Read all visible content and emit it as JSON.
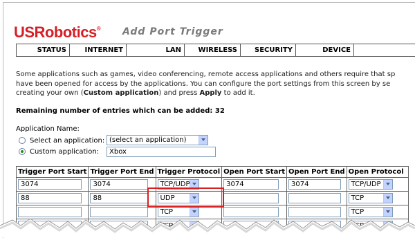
{
  "header": {
    "logo": "USRobotics",
    "logo_mark": "®",
    "title": "Add Port Trigger"
  },
  "nav": [
    "STATUS",
    "INTERNET",
    "LAN",
    "WIRELESS",
    "SECURITY",
    "DEVICE"
  ],
  "intro": {
    "line1": "Some applications such as games, video conferencing, remote access applications and others require that sp",
    "line2": "have been opened for access by the applications. You can configure the port settings from this screen by se",
    "line3_pre": "creating your own (",
    "line3_custom": "Custom application",
    "line3_mid": ") and press ",
    "line3_apply": "Apply",
    "line3_post": " to add it."
  },
  "remaining": {
    "label": "Remaining number of entries which can be added:",
    "value": "32"
  },
  "application": {
    "label": "Application Name:",
    "select_label": "Select an application:",
    "select_value": "(select an application)",
    "custom_label": "Custom application:",
    "custom_value": "Xbox",
    "selected_option": "custom"
  },
  "table": {
    "headers": [
      "Trigger Port Start",
      "Trigger Port End",
      "Trigger Protocol",
      "Open Port Start",
      "Open Port End",
      "Open Protocol"
    ],
    "rows": [
      {
        "trigger_start": "3074",
        "trigger_end": "3074",
        "trigger_protocol": "TCP/UDP",
        "open_start": "3074",
        "open_end": "3074",
        "open_protocol": "TCP/UDP"
      },
      {
        "trigger_start": "88",
        "trigger_end": "88",
        "trigger_protocol": "UDP",
        "open_start": "",
        "open_end": "",
        "open_protocol": "TCP"
      },
      {
        "trigger_start": "",
        "trigger_end": "",
        "trigger_protocol": "TCP",
        "open_start": "",
        "open_end": "",
        "open_protocol": "TCP"
      },
      {
        "trigger_start": "",
        "trigger_end": "",
        "trigger_protocol": "TCP",
        "open_start": "",
        "open_end": "",
        "open_protocol": "TCP"
      }
    ]
  },
  "colors": {
    "brand_red": "#d61f26",
    "highlight": "#d81e1e",
    "title_gray": "#7a7a7a"
  }
}
